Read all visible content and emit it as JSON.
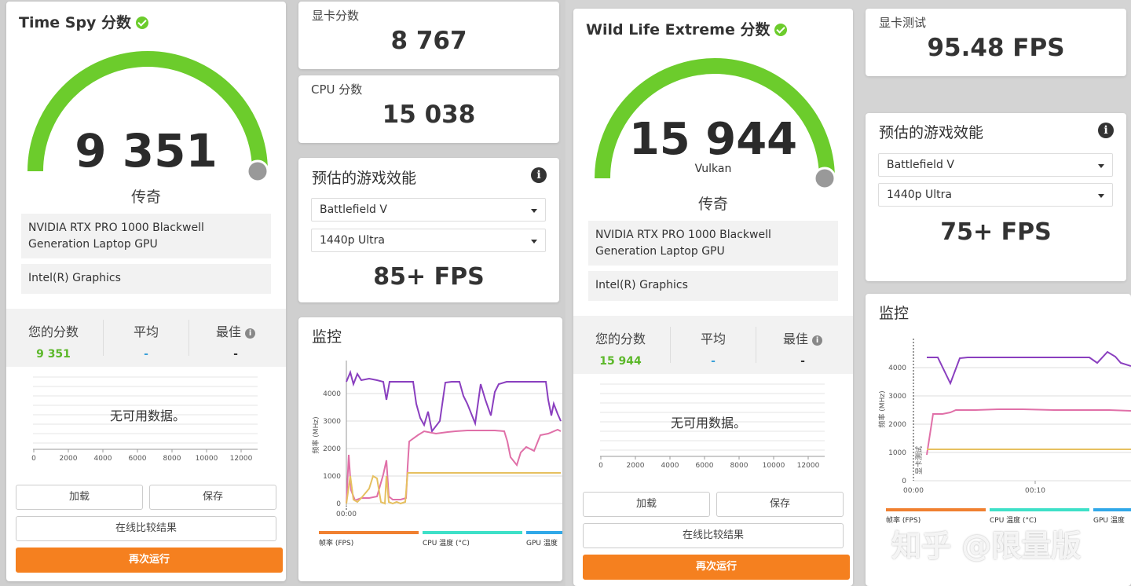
{
  "left_panel": {
    "title": "Time Spy 分数",
    "score": "9 351",
    "rank": "传奇",
    "gpu_name": "NVIDIA RTX PRO 1000 Blackwell Generation Laptop GPU",
    "igpu_name": "Intel(R) Graphics",
    "stats": {
      "your_score_label": "您的分数",
      "your_score": "9 351",
      "average_label": "平均",
      "average": "-",
      "best_label": "最佳",
      "best": "-"
    },
    "histogram": {
      "no_data": "无可用数据。",
      "ticks": [
        "0",
        "2000",
        "4000",
        "6000",
        "8000",
        "10000",
        "12000"
      ]
    },
    "buttons": {
      "load": "加载",
      "save": "保存",
      "compare": "在线比较结果",
      "run_again": "再次运行"
    }
  },
  "mid_panel": {
    "gpu_score_label": "显卡分数",
    "gpu_score": "8 767",
    "cpu_score_label": "CPU 分数",
    "cpu_score": "15 038",
    "game_perf_label": "预估的游戏效能",
    "game": "Battlefield V",
    "preset": "1440p Ultra",
    "fps": "85+ FPS",
    "monitor": {
      "title": "监控",
      "y_axis_label": "频率 (MHz)",
      "y_ticks": [
        "0",
        "1000",
        "2000",
        "3000",
        "4000"
      ],
      "x_tick": "00:00",
      "legend": [
        "帧率 (FPS)",
        "CPU 温度 (°C)",
        "GPU 温度"
      ]
    }
  },
  "right_left_panel": {
    "title": "Wild Life Extreme 分数",
    "score": "15 944",
    "api": "Vulkan",
    "rank": "传奇",
    "gpu_name": "NVIDIA RTX PRO 1000 Blackwell Generation Laptop GPU",
    "igpu_name": "Intel(R) Graphics",
    "stats": {
      "your_score_label": "您的分数",
      "your_score": "15 944",
      "average_label": "平均",
      "average": "-",
      "best_label": "最佳",
      "best": "-"
    },
    "histogram": {
      "no_data": "无可用数据。",
      "ticks": [
        "0",
        "2000",
        "4000",
        "6000",
        "8000",
        "10000",
        "12000"
      ]
    },
    "buttons": {
      "load": "加载",
      "save": "保存",
      "compare": "在线比较结果",
      "run_again": "再次运行"
    }
  },
  "right_panel": {
    "gpu_test_label": "显卡测试",
    "gpu_test_fps": "95.48 FPS",
    "game_perf_label": "预估的游戏效能",
    "game": "Battlefield V",
    "preset": "1440p Ultra",
    "fps": "75+ FPS",
    "monitor": {
      "title": "监控",
      "y_axis_label": "频率 (MHz)",
      "y_ticks": [
        "0",
        "1000",
        "2000",
        "3000",
        "4000"
      ],
      "x_ticks": [
        "00:00",
        "00:10"
      ],
      "marker_label": "显卡测试",
      "legend": [
        "帧率 (FPS)",
        "CPU 温度 (°C)",
        "GPU 温度"
      ]
    }
  },
  "watermark": "知乎 @限量版",
  "colors": {
    "accent_orange": "#f5801f",
    "gauge_green": "#6ccc2c",
    "score_green": "#5cb82a",
    "avg_blue": "#3aa0d8",
    "line_purple": "#8a3fbf",
    "line_pink": "#e070a8",
    "line_yellow": "#e6c060",
    "legend_orange": "#f08030",
    "legend_teal": "#3ee0c8",
    "legend_blue": "#30a8e8"
  }
}
